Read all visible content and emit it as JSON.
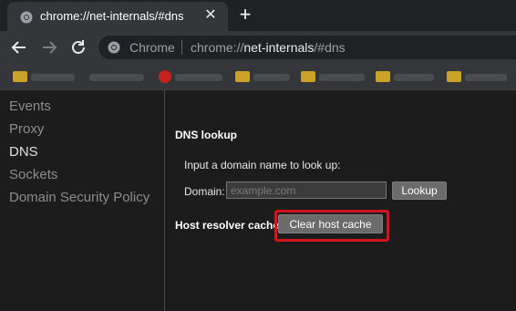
{
  "tab": {
    "title": "chrome://net-internals/#dns",
    "favicon": "chrome-icon"
  },
  "toolbar": {
    "omnibox_site": "Chrome",
    "url_scheme": "chrome://",
    "url_host": "net-internals",
    "url_rest": "/#dns"
  },
  "sidebar": {
    "items": [
      {
        "label": "Events",
        "active": false
      },
      {
        "label": "Proxy",
        "active": false
      },
      {
        "label": "DNS",
        "active": true
      },
      {
        "label": "Sockets",
        "active": false
      },
      {
        "label": "Domain Security Policy",
        "active": false
      }
    ]
  },
  "dns": {
    "section_title": "DNS lookup",
    "prompt": "Input a domain name to look up:",
    "domain_label": "Domain:",
    "domain_value": "",
    "domain_placeholder": "example.com",
    "lookup_label": "Lookup",
    "resolver_label": "Host resolver cache",
    "clear_label": "Clear host cache"
  },
  "colors": {
    "highlight": "#d3141f",
    "accent_bookmark": "#c9a227"
  }
}
